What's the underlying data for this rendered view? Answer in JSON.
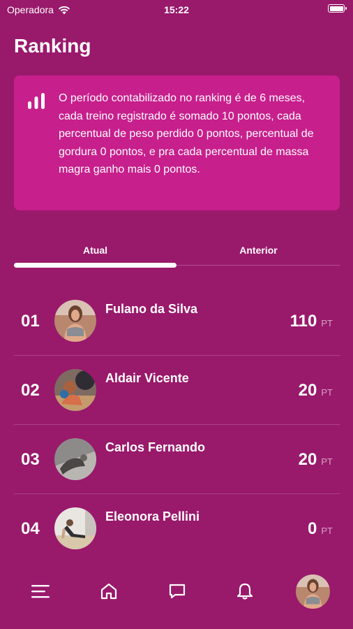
{
  "status_bar": {
    "carrier": "Operadora",
    "time": "15:22"
  },
  "page": {
    "title": "Ranking"
  },
  "info": {
    "icon": "bar-chart-icon",
    "text": "O período contabilizado no ranking é de 6 meses, cada treino registrado é somado 10 pontos, cada percentual de peso perdido 0 pontos, percentual de gordura 0 pontos, e pra cada percentual de massa magra ganho mais 0 pontos."
  },
  "tabs": {
    "active": "Atual",
    "items": [
      {
        "label": "Atual"
      },
      {
        "label": "Anterior"
      }
    ]
  },
  "ranking": [
    {
      "position": "01",
      "name": "Fulano da Silva",
      "points": "110",
      "unit": "PT"
    },
    {
      "position": "02",
      "name": "Aldair Vicente",
      "points": "20",
      "unit": "PT"
    },
    {
      "position": "03",
      "name": "Carlos Fernando",
      "points": "20",
      "unit": "PT"
    },
    {
      "position": "04",
      "name": "Eleonora Pellini",
      "points": "0",
      "unit": "PT"
    }
  ],
  "bottom_nav": {
    "items": [
      "menu-icon",
      "home-icon",
      "chat-icon",
      "bell-icon",
      "profile-avatar"
    ]
  },
  "colors": {
    "background": "#99196b",
    "card": "#c71f8c",
    "text": "#ffffff"
  }
}
